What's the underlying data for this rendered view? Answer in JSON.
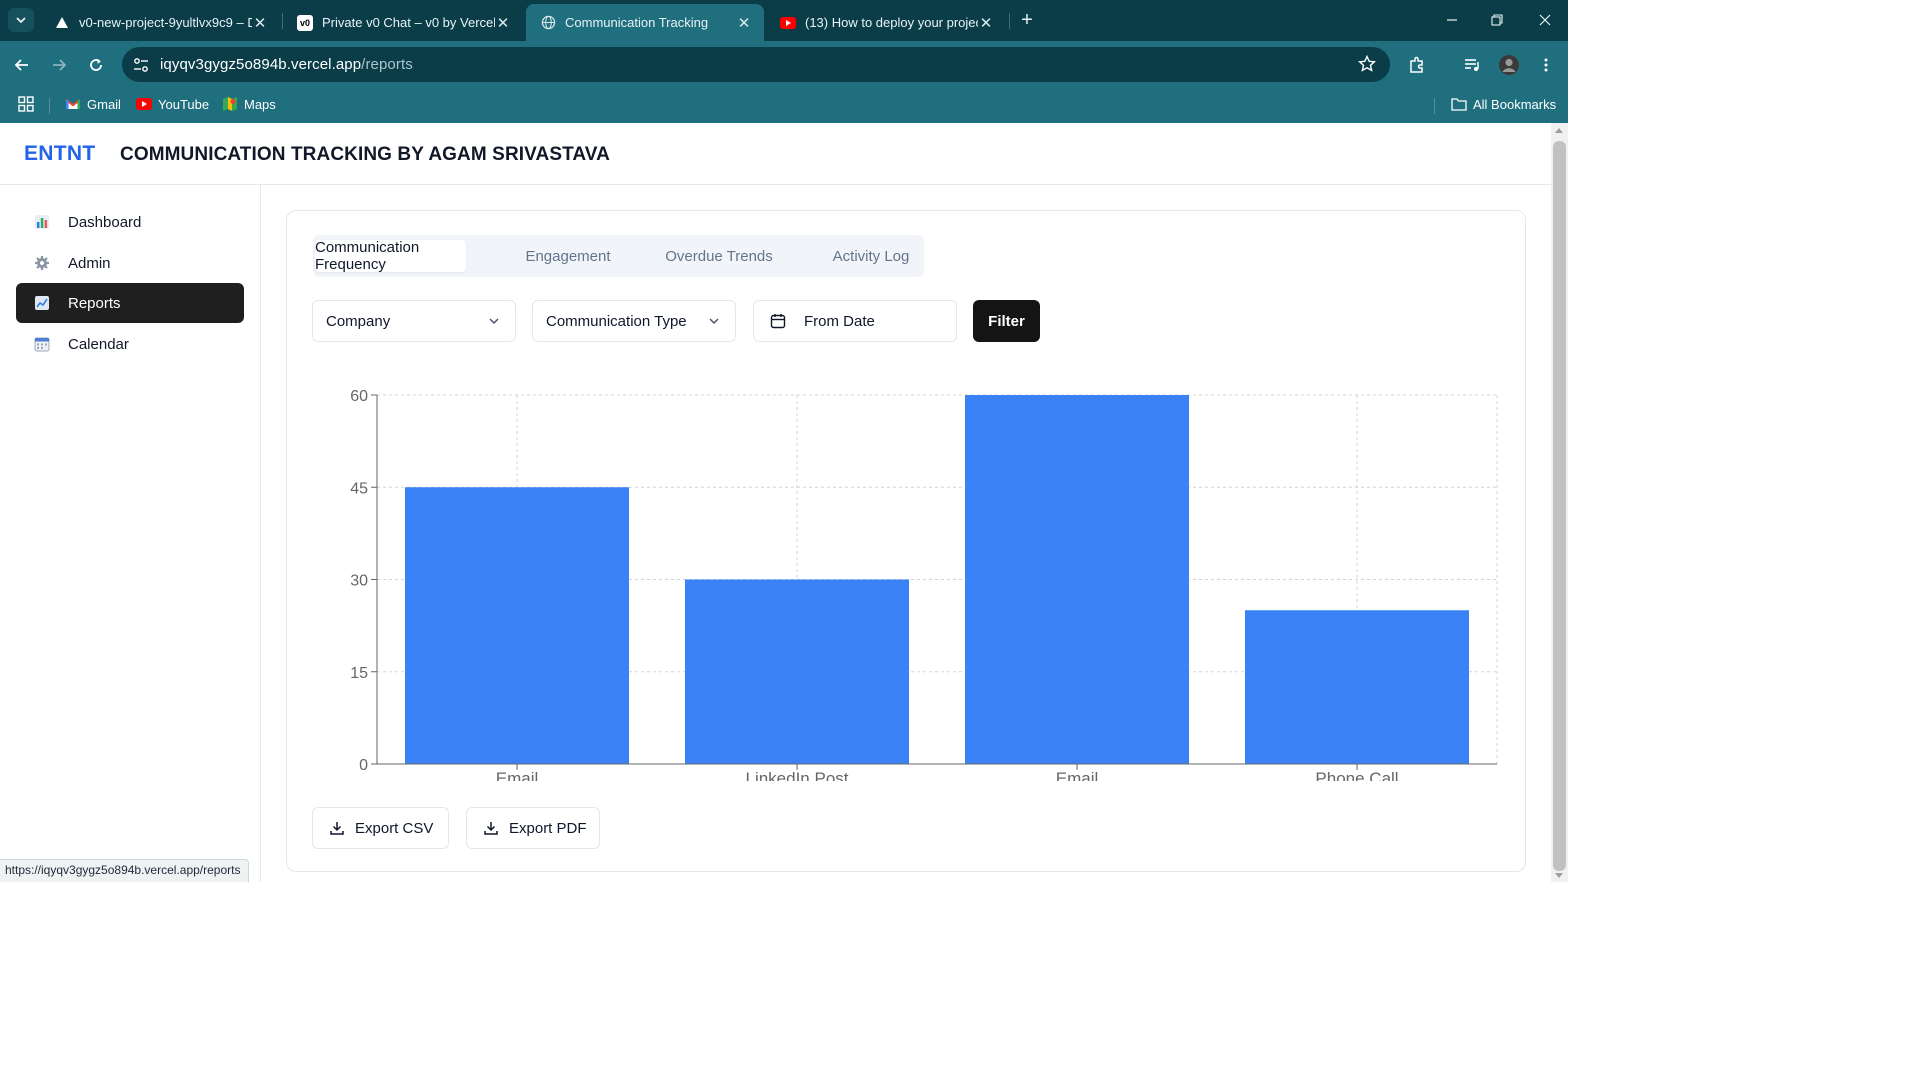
{
  "browser": {
    "tabs": [
      {
        "title": "v0-new-project-9yultlvx9c9 – D",
        "favicon": "vercel-triangle-icon",
        "active": false
      },
      {
        "title": "Private v0 Chat – v0 by Vercel",
        "favicon": "v0-logo-icon",
        "active": false
      },
      {
        "title": "Communication Tracking",
        "favicon": "globe-icon",
        "active": true
      },
      {
        "title": "(13) How to deploy your projec",
        "favicon": "youtube-icon",
        "active": false
      }
    ],
    "url": {
      "host": "iqyqv3gygz5o894b.vercel.app",
      "path": "/reports"
    },
    "bookmarks": [
      {
        "label": "Gmail",
        "icon": "gmail-icon"
      },
      {
        "label": "YouTube",
        "icon": "youtube-icon"
      },
      {
        "label": "Maps",
        "icon": "maps-icon"
      }
    ],
    "all_bookmarks_label": "All Bookmarks",
    "status_url": "https://iqyqv3gygz5o894b.vercel.app/reports"
  },
  "header": {
    "brand": "ENTNT",
    "title": "COMMUNICATION TRACKING BY AGAM SRIVASTAVA"
  },
  "sidebar": {
    "items": [
      {
        "label": "Dashboard",
        "icon": "bar-chart-icon",
        "active": false
      },
      {
        "label": "Admin",
        "icon": "gear-icon",
        "active": false
      },
      {
        "label": "Reports",
        "icon": "line-chart-icon",
        "active": true
      },
      {
        "label": "Calendar",
        "icon": "calendar-icon",
        "active": false
      }
    ]
  },
  "reports": {
    "tabs": [
      {
        "label": "Communication Frequency",
        "active": true
      },
      {
        "label": "Engagement",
        "active": false
      },
      {
        "label": "Overdue Trends",
        "active": false
      },
      {
        "label": "Activity Log",
        "active": false
      }
    ],
    "filters": {
      "company_label": "Company",
      "type_label": "Communication Type",
      "date_label": "From Date",
      "filter_button": "Filter"
    },
    "export": {
      "csv_label": "Export CSV",
      "pdf_label": "Export PDF"
    }
  },
  "colors": {
    "brand": "#2563eb",
    "bar": "#3b82f6",
    "active_nav": "#1f1f1f"
  },
  "chart_data": {
    "type": "bar",
    "categories": [
      "Email",
      "LinkedIn Post",
      "Email",
      "Phone Call"
    ],
    "values": [
      45,
      30,
      60,
      25
    ],
    "yticks": [
      0,
      15,
      30,
      45,
      60
    ],
    "ylim": [
      0,
      60
    ],
    "grid": true,
    "title": "",
    "xlabel": "",
    "ylabel": ""
  }
}
